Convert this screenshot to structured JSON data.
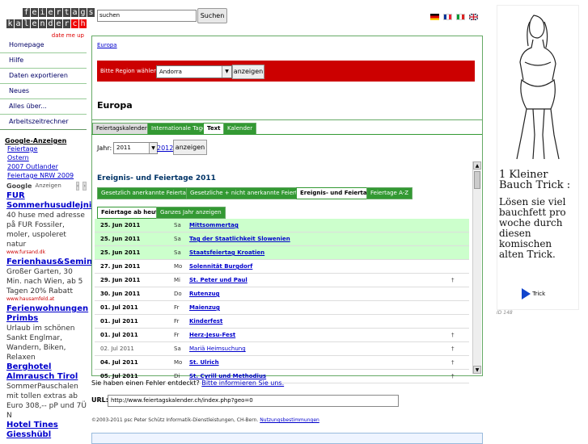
{
  "logo": {
    "row1": "feiertags",
    "row2": "kalender",
    "row2_red": "ch",
    "sub": "date me up"
  },
  "nav": [
    "Homepage",
    "Hilfe",
    "Daten exportieren",
    "Neues",
    "Alles über...",
    "Arbeitszeitrechner"
  ],
  "google_ads_links": {
    "title": "Google-Anzeigen",
    "items": [
      "Feiertage",
      "Ostern",
      "2007 Outlander",
      "Feiertage NRW 2009"
    ]
  },
  "google_ads_label": "Anzeigen",
  "ads": [
    {
      "title": "FUR Sommerhusudlejning",
      "body": "40 huse med adresse på FUR Fossiler, moler, uspoleret natur",
      "url": "www.fursand.dk"
    },
    {
      "title": "Ferienhaus&Seminar",
      "body": "Großer Garten, 30 Min. nach Wien, ab 5 Tagen 20% Rabatt",
      "url": "www.hausamfeld.at"
    },
    {
      "title": "Ferienwohnungen Primbs",
      "body": "Urlaub im schönen Sankt Englmar, Wandern, Biken, Relaxen",
      "url": ""
    },
    {
      "title": "Berghotel Almrausch Tirol",
      "body": "SommerPauschalen mit tollen extras ab Euro 308,-- pP und 7Ü N",
      "url": ""
    },
    {
      "title": "Hotel Tines Giesshübl",
      "body": "",
      "url": ""
    }
  ],
  "search": {
    "value": "suchen",
    "button": "Suchen"
  },
  "breadcrumb": "Europa",
  "region": {
    "label": "Bitte Region wählen :",
    "selected": "Andorra",
    "button": "anzeigen"
  },
  "page_title": "Europa",
  "tabs": [
    "Feiertagskalender",
    "Internationale Tage",
    "Text",
    "Kalender"
  ],
  "year": {
    "label": "Jahr:",
    "selected": "2011",
    "next": "2012",
    "button": "anzeigen"
  },
  "section_title": "Ereignis- und Feiertage 2011",
  "subtabs": [
    "Gesetzlich anerkannte Feiertage",
    "Gesetzliche + nicht anerkannte Feiertage",
    "Ereignis- und Feiertage",
    "Feiertage A-Z"
  ],
  "viewtabs": [
    "Feiertage ab heute",
    "Ganzes Jahr anzeigen"
  ],
  "rows": [
    {
      "date": "25. Jun 2011",
      "wd": "Sa",
      "name": "Mittsommertag",
      "mark": "",
      "hl": true,
      "dim": false
    },
    {
      "date": "25. Jun 2011",
      "wd": "Sa",
      "name": "Tag der Staatlichkeit Slowenien",
      "mark": "",
      "hl": true,
      "dim": false
    },
    {
      "date": "25. Jun 2011",
      "wd": "Sa",
      "name": "Staatsfeiertag Kroatien",
      "mark": "",
      "hl": true,
      "dim": false
    },
    {
      "date": "27. Jun 2011",
      "wd": "Mo",
      "name": "Solennität Burgdorf",
      "mark": "",
      "hl": false,
      "dim": false
    },
    {
      "date": "29. Jun 2011",
      "wd": "Mi",
      "name": "St. Peter und Paul",
      "mark": "†",
      "hl": false,
      "dim": false
    },
    {
      "date": "30. Jun 2011",
      "wd": "Do",
      "name": "Rutenzug",
      "mark": "",
      "hl": false,
      "dim": false
    },
    {
      "date": "01. Jul 2011",
      "wd": "Fr",
      "name": "Maienzug",
      "mark": "",
      "hl": false,
      "dim": false
    },
    {
      "date": "01. Jul 2011",
      "wd": "Fr",
      "name": "Kinderfest",
      "mark": "",
      "hl": false,
      "dim": false
    },
    {
      "date": "01. Jul 2011",
      "wd": "Fr",
      "name": "Herz-Jesu-Fest",
      "mark": "†",
      "hl": false,
      "dim": false
    },
    {
      "date": "02. Jul 2011",
      "wd": "Sa",
      "name": "Mariä Heimsuchung",
      "mark": "†",
      "hl": false,
      "dim": true
    },
    {
      "date": "04. Jul 2011",
      "wd": "Mo",
      "name": "St. Ulrich",
      "mark": "†",
      "hl": false,
      "dim": false
    },
    {
      "date": "05. Jul 2011",
      "wd": "Di",
      "name": "St. Cyrill und Methodius",
      "mark": "†",
      "hl": false,
      "dim": false
    }
  ],
  "error_text": "Sie haben einen Fehler entdeckt?",
  "error_link": "Bitte informieren Sie uns.",
  "url": {
    "label": "URL:",
    "value": "http://www.feiertagskalender.ch/index.php?geo=0"
  },
  "copyright": "©2003-2011 psc Peter Schütz Informatik-Dienstleistungen, CH-Bern.",
  "terms_link": "Nutzungsbestimmungen",
  "right_ad": {
    "line1": "1 Kleiner Bauch Trick :",
    "line2": "Lösen sie viel bauchfett pro woche durch diesen komischen alten Trick.",
    "link": "Trick",
    "id": "ID 148"
  },
  "colors": {
    "green": "#339933",
    "red": "#cc0000",
    "highlight": "#ccffcc",
    "link": "#0000cc"
  }
}
